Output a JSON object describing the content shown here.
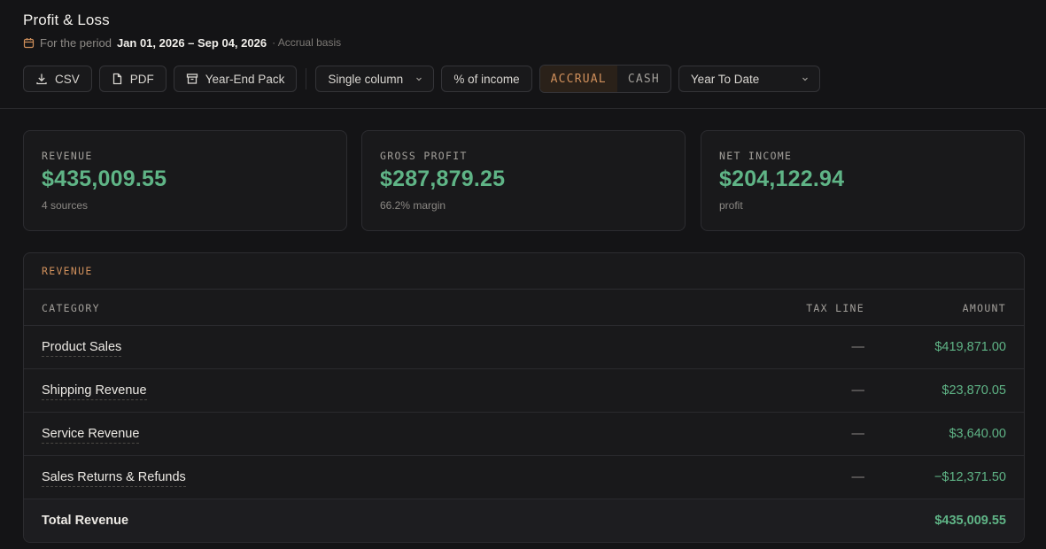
{
  "header": {
    "title": "Profit & Loss",
    "period_prefix": "For the period",
    "period_range": "Jan 01, 2026 – Sep 04, 2026",
    "basis": "· Accrual basis"
  },
  "toolbar": {
    "csv_label": "CSV",
    "pdf_label": "PDF",
    "year_end_label": "Year-End Pack",
    "layout_select": "Single column",
    "percent_label": "% of income",
    "accrual_label": "ACCRUAL",
    "cash_label": "CASH",
    "range_select": "Year To Date"
  },
  "cards": [
    {
      "label": "REVENUE",
      "value": "$435,009.55",
      "note": "4 sources"
    },
    {
      "label": "GROSS PROFIT",
      "value": "$287,879.25",
      "note": "66.2% margin"
    },
    {
      "label": "NET INCOME",
      "value": "$204,122.94",
      "note": "profit"
    }
  ],
  "revenue_table": {
    "section_title": "REVENUE",
    "columns": {
      "category": "CATEGORY",
      "tax_line": "TAX LINE",
      "amount": "AMOUNT"
    },
    "rows": [
      {
        "category": "Product Sales",
        "tax_line": "—",
        "amount": "$419,871.00"
      },
      {
        "category": "Shipping Revenue",
        "tax_line": "—",
        "amount": "$23,870.05"
      },
      {
        "category": "Service Revenue",
        "tax_line": "—",
        "amount": "$3,640.00"
      },
      {
        "category": "Sales Returns & Refunds",
        "tax_line": "—",
        "amount": "−$12,371.50"
      }
    ],
    "total": {
      "label": "Total Revenue",
      "amount": "$435,009.55"
    }
  },
  "colors": {
    "accent": "#cf8f5b",
    "positive": "#5fb486",
    "background": "#141416"
  }
}
